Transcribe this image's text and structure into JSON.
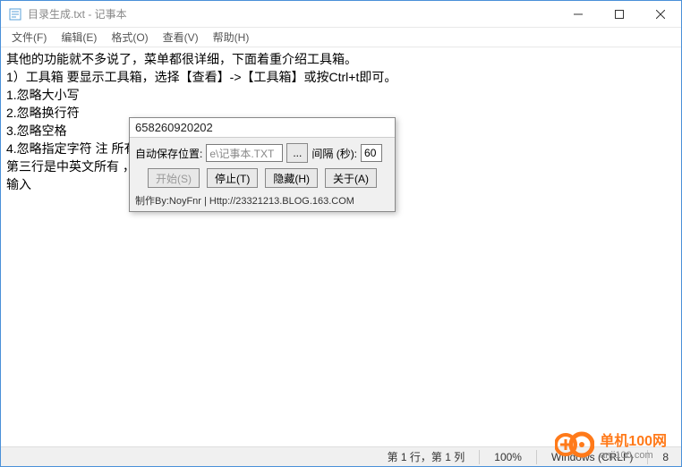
{
  "window": {
    "title": "目录生成.txt - 记事本"
  },
  "menu": {
    "file": "文件(F)",
    "edit": "编辑(E)",
    "format": "格式(O)",
    "view": "查看(V)",
    "help": "帮助(H)"
  },
  "content_lines": [
    "其他的功能就不多说了，菜单都很详细，下面着重介绍工具箱。",
    "1）工具箱 要显示工具箱，选择【查看】->【工具箱】或按Ctrl+t即可。",
    "1.忽略大小写",
    "2.忽略换行符",
    "3.忽略空格",
    "4.忽略指定字符 注                                                                          所有英文标点，第二行是所有中文标点",
    "第三行是中英文所有                                                            ，比如要忽略“a”和“b”则在组合框内",
    "输入"
  ],
  "dialog": {
    "title": "658260920202",
    "save_label": "自动保存位置:",
    "save_path": "e\\记事本.TXT",
    "browse": "...",
    "interval_label": "间隔 (秒):",
    "interval_value": "60",
    "btn_start": "开始(S)",
    "btn_stop": "停止(T)",
    "btn_hide": "隐藏(H)",
    "btn_about": "关于(A)",
    "footer": "制作By:NoyFnr | Http://23321213.BLOG.163.COM"
  },
  "statusbar": {
    "position": "第 1 行，第 1 列",
    "zoom": "100%",
    "line_ending": "Windows (CRLF)",
    "encoding": "8"
  },
  "watermark": {
    "text": "单机100网",
    "url": "anji100.com"
  }
}
